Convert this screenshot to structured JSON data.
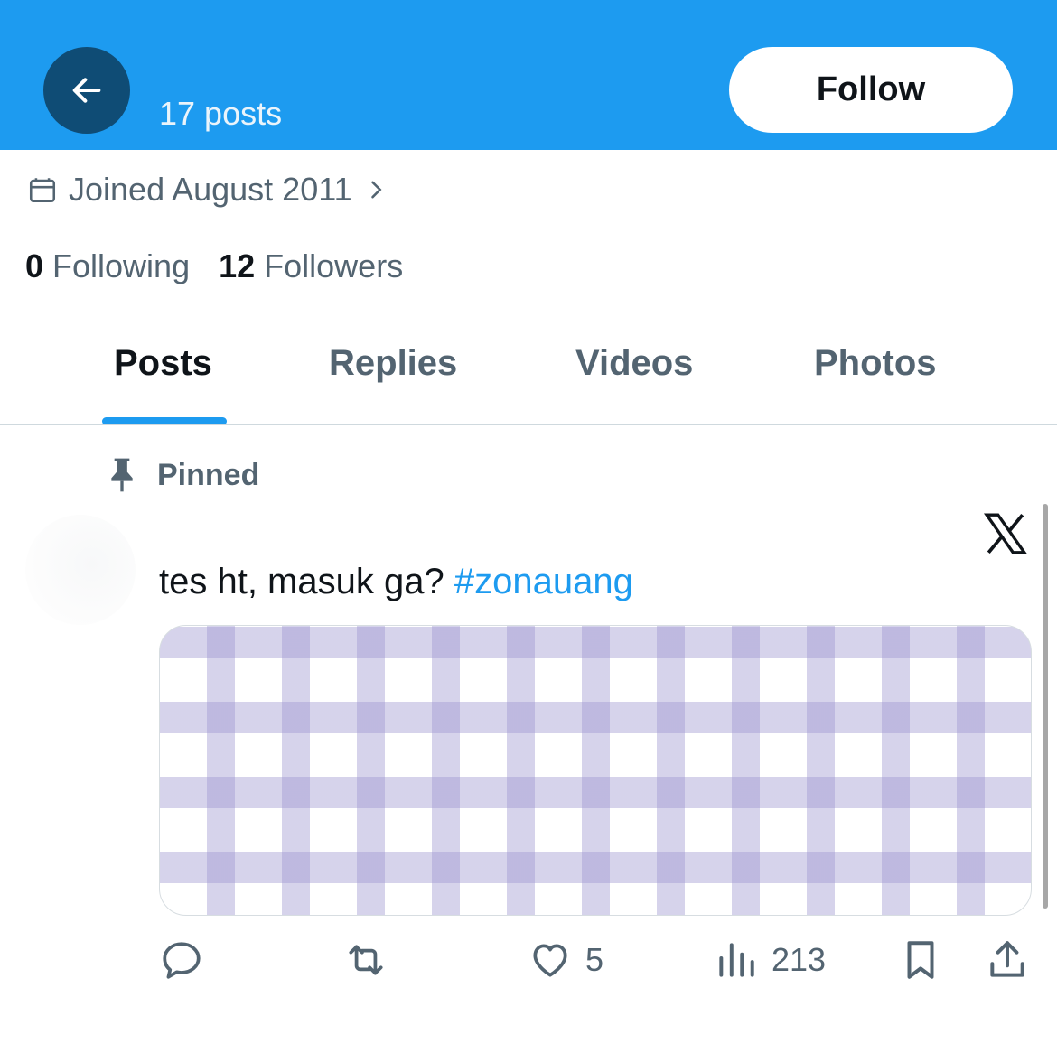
{
  "colors": {
    "accent": "#1d9bf0",
    "link": "#1d9bf0"
  },
  "header": {
    "post_count": "17 posts",
    "follow_label": "Follow",
    "back_icon": "arrow-left-icon"
  },
  "profile": {
    "joined": "Joined August 2011",
    "following_count": "0",
    "following_label": "Following",
    "followers_count": "12",
    "followers_label": "Followers"
  },
  "tabs": [
    {
      "label": "Posts",
      "active": true
    },
    {
      "label": "Replies",
      "active": false
    },
    {
      "label": "Videos",
      "active": false
    },
    {
      "label": "Photos",
      "active": false
    }
  ],
  "post": {
    "pinned_label": "Pinned",
    "text": "tes ht, masuk ga?",
    "hashtag": "#zonauang",
    "like_count": "5",
    "view_count": "213"
  }
}
